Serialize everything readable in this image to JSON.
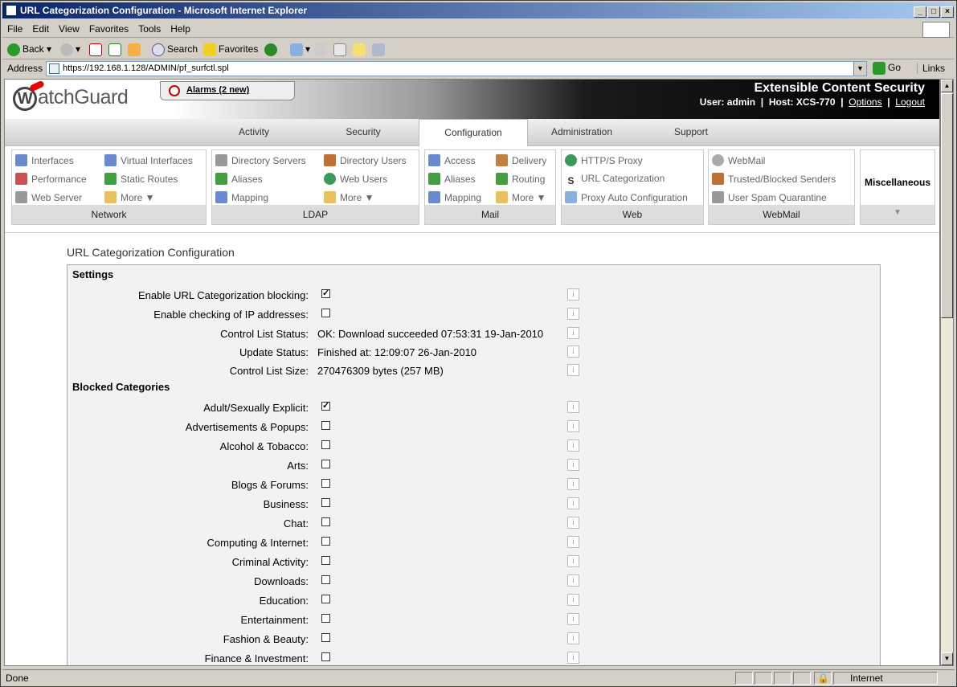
{
  "window": {
    "title": "URL Categorization Configuration - Microsoft Internet Explorer"
  },
  "menu": [
    "File",
    "Edit",
    "View",
    "Favorites",
    "Tools",
    "Help"
  ],
  "toolbar": {
    "back": "Back",
    "search": "Search",
    "favorites": "Favorites"
  },
  "address": {
    "label": "Address",
    "url": "https://192.168.1.128/ADMIN/pf_surfctl.spl",
    "go": "Go",
    "links": "Links"
  },
  "status": {
    "text": "Done",
    "zone": "Internet"
  },
  "header": {
    "logo": "atchGuard",
    "alarms": "Alarms (2 new)",
    "product": "Extensible Content Security",
    "user_label": "User:",
    "user": "admin",
    "host_label": "Host:",
    "host": "XCS-770",
    "sep": "|",
    "options": "Options",
    "logout": "Logout"
  },
  "tabs": [
    {
      "label": "Activity",
      "active": false
    },
    {
      "label": "Security",
      "active": false
    },
    {
      "label": "Configuration",
      "active": true
    },
    {
      "label": "Administration",
      "active": false
    },
    {
      "label": "Support",
      "active": false
    }
  ],
  "nav_groups": [
    {
      "title": "Network",
      "items": [
        "Interfaces",
        "Virtual Interfaces",
        "Performance",
        "Static Routes",
        "Web Server",
        "More ▼"
      ]
    },
    {
      "title": "LDAP",
      "items": [
        "Directory Servers",
        "Directory Users",
        "Aliases",
        "Web Users",
        "Mapping",
        "More ▼"
      ]
    },
    {
      "title": "Mail",
      "items": [
        "Access",
        "Delivery",
        "Aliases",
        "Routing",
        "Mapping",
        "More ▼"
      ]
    },
    {
      "title": "Web",
      "items": [
        "HTTP/S Proxy",
        "URL Categorization",
        "Proxy Auto Configuration"
      ]
    },
    {
      "title": "WebMail",
      "items": [
        "WebMail",
        "Trusted/Blocked Senders",
        "User Spam Quarantine"
      ]
    }
  ],
  "misc": {
    "label": "Miscellaneous",
    "arrow": "▼"
  },
  "page": {
    "title": "URL Categorization Configuration",
    "settings_heading": "Settings",
    "settings": [
      {
        "label": "Enable URL Categorization blocking:",
        "checked": true
      },
      {
        "label": "Enable checking of IP addresses:",
        "checked": false
      },
      {
        "label": "Control List Status:",
        "value": "OK: Download succeeded 07:53:31 19-Jan-2010"
      },
      {
        "label": "Update Status:",
        "value": "Finished at: 12:09:07 26-Jan-2010"
      },
      {
        "label": "Control List Size:",
        "value": "270476309 bytes (257 MB)"
      }
    ],
    "blocked_heading": "Blocked Categories",
    "categories": [
      {
        "label": "Adult/Sexually Explicit:",
        "checked": true
      },
      {
        "label": "Advertisements & Popups:",
        "checked": false
      },
      {
        "label": "Alcohol & Tobacco:",
        "checked": false
      },
      {
        "label": "Arts:",
        "checked": false
      },
      {
        "label": "Blogs & Forums:",
        "checked": false
      },
      {
        "label": "Business:",
        "checked": false
      },
      {
        "label": "Chat:",
        "checked": false
      },
      {
        "label": "Computing & Internet:",
        "checked": false
      },
      {
        "label": "Criminal Activity:",
        "checked": false
      },
      {
        "label": "Downloads:",
        "checked": false
      },
      {
        "label": "Education:",
        "checked": false
      },
      {
        "label": "Entertainment:",
        "checked": false
      },
      {
        "label": "Fashion & Beauty:",
        "checked": false
      },
      {
        "label": "Finance & Investment:",
        "checked": false
      }
    ],
    "info_glyph": "i"
  }
}
